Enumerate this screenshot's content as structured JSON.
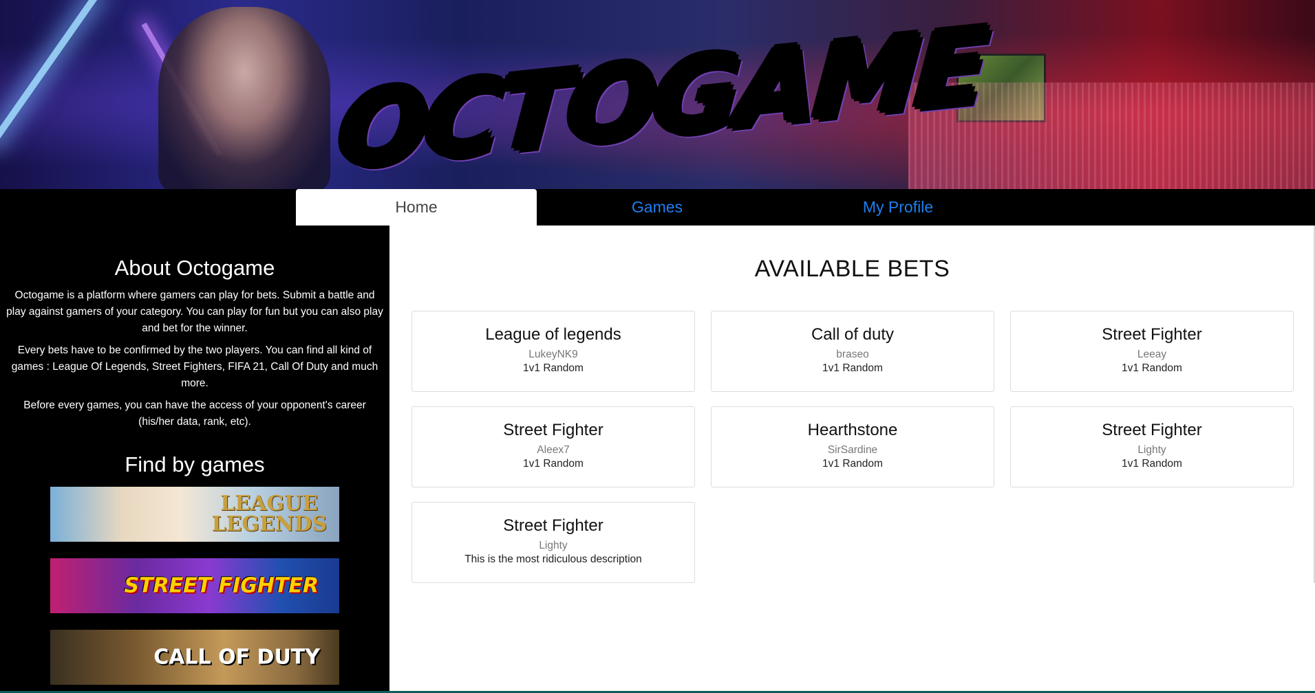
{
  "banner": {
    "logo_text": "OCTOGAME"
  },
  "nav": {
    "tabs": [
      {
        "label": "Home",
        "active": true
      },
      {
        "label": "Games",
        "active": false
      },
      {
        "label": "My Profile",
        "active": false
      }
    ]
  },
  "sidebar": {
    "about_title": "About Octogame",
    "paragraphs": [
      "Octogame is a platform where gamers can play for bets. Submit a battle and play against gamers of your category. You can play for fun but you can also play and bet for the winner.",
      "Every bets have to be confirmed by the two players. You can find all kind of games : League Of Legends, Street Fighters, FIFA 21, Call Of Duty and much more.",
      "Before every games, you can have the access of your opponent's career (his/her data, rank, etc)."
    ],
    "find_title": "Find by games",
    "games": [
      {
        "label": "LEAGUE OF LEGENDS",
        "line1": "LEAGUE",
        "line2": "LEGENDS"
      },
      {
        "label": "STREET FIGHTER"
      },
      {
        "label": "CALL OF DUTY"
      }
    ]
  },
  "main": {
    "title": "AVAILABLE BETS",
    "bets": [
      {
        "game": "League of legends",
        "user": "LukeyNK9",
        "description": "1v1 Random"
      },
      {
        "game": "Call of duty",
        "user": "braseo",
        "description": "1v1 Random"
      },
      {
        "game": "Street Fighter",
        "user": "Leeay",
        "description": "1v1 Random"
      },
      {
        "game": "Street Fighter",
        "user": "Aleex7",
        "description": "1v1 Random"
      },
      {
        "game": "Hearthstone",
        "user": "SirSardine",
        "description": "1v1 Random"
      },
      {
        "game": "Street Fighter",
        "user": "Lighty",
        "description": "1v1 Random"
      },
      {
        "game": "Street Fighter",
        "user": "Lighty",
        "description": "This is the most ridiculous description"
      }
    ]
  },
  "colors": {
    "link_blue": "#1e7ff0",
    "sidebar_bg": "#000000",
    "card_border": "#dcdcdc"
  }
}
